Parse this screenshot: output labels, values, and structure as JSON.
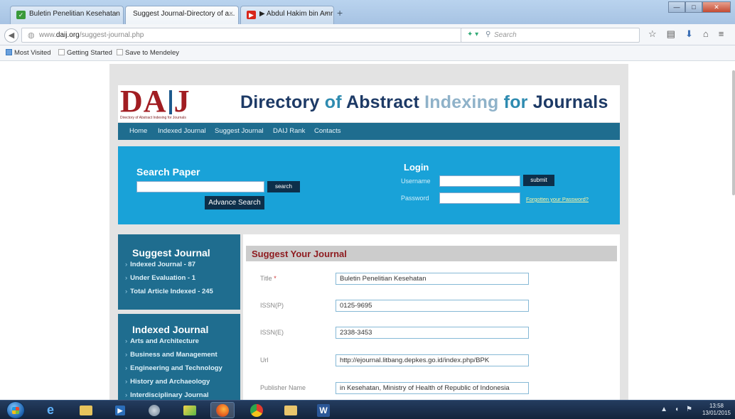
{
  "browser": {
    "tabs": [
      {
        "title": "Buletin Penelitian Kesehatan",
        "favicon": "leaf-icon",
        "favicon_color": "#3a9a3a",
        "close": "×",
        "active": false
      },
      {
        "title": "Suggest Journal-Directory of a...",
        "favicon": "",
        "favicon_color": "",
        "close": "×",
        "active": true
      },
      {
        "title": "▶ Abdul Hakim bin Amr ...",
        "favicon": "youtube-icon",
        "favicon_color": "#d8261b",
        "close": "×",
        "active": false
      }
    ],
    "new_tab": "+",
    "url_prefix": "www.",
    "url_domain": "daij.org",
    "url_path": "/suggest-journal.php",
    "search_placeholder": "Search",
    "bookmarks": [
      "Most Visited",
      "Getting Started",
      "Save to Mendeley"
    ]
  },
  "site": {
    "logo_letters_a": "DA",
    "logo_letters_b": "J",
    "logo_tagline": "Directory of Abstract Indexing for Journals",
    "title_part1": "Directory",
    "title_part2": " of ",
    "title_part3": "Abstract",
    "title_part4": " Indexing ",
    "title_part5": "for",
    "title_part6": " Journals",
    "menu": [
      "Home",
      "Indexed Journal",
      "Suggest Journal",
      "DAIJ Rank",
      "Contacts"
    ],
    "search_title": "Search Paper",
    "search_button": "search",
    "advance_search": "Advance Search",
    "login_title": "Login",
    "username_label": "Username",
    "password_label": "Password",
    "submit_button": "submit",
    "forgot_link": "Forgotten your Password?"
  },
  "sidebar": {
    "suggest": {
      "title": "Suggest Journal",
      "items": [
        "Indexed Journal - 87",
        "Under Evaluation - 1",
        "Total Article Indexed - 245"
      ]
    },
    "indexed": {
      "title": "Indexed Journal",
      "items": [
        "Arts and Architecture",
        "Business and Management",
        "Engineering and Technology",
        "History and Archaeology",
        "Interdisciplinary Journal"
      ]
    }
  },
  "form": {
    "heading": "Suggest Your Journal",
    "fields": [
      {
        "label": "Title",
        "required": "*",
        "value": "Buletin Penelitian Kesehatan"
      },
      {
        "label": "ISSN(P)",
        "required": "",
        "value": "0125-9695"
      },
      {
        "label": "ISSN(E)",
        "required": "",
        "value": "2338-3453"
      },
      {
        "label": "Url",
        "required": "",
        "value": "http://ejournal.litbang.depkes.go.id/index.php/BPK"
      },
      {
        "label": "Publisher Name",
        "required": "",
        "value": "in Kesehatan, Ministry of Health of Republic of Indonesia"
      }
    ]
  },
  "taskbar": {
    "apps": [
      "ie-icon",
      "explorer-icon",
      "media-player-icon",
      "network-icon",
      "paint-icon",
      "firefox-icon",
      "chrome-icon",
      "folder-icon",
      "word-icon"
    ],
    "time": "13:58",
    "date": "13/01/2015"
  },
  "colors": {
    "site_bg": "#e3e3e3",
    "menu_bar": "#1f6d8f",
    "login_panel": "#19a2d8",
    "heading_red": "#8e1b1f",
    "logo_red": "#a11d22"
  }
}
